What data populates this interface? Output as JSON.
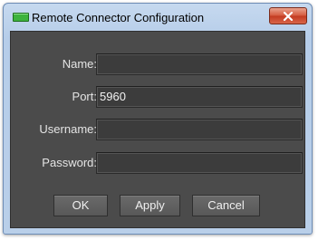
{
  "window": {
    "title": "Remote Connector Configuration"
  },
  "icons": {
    "app": "green-plug-icon",
    "close": "close-x-icon"
  },
  "form": {
    "name_label": "Name:",
    "name_value": "",
    "port_label": "Port:",
    "port_value": "5960",
    "username_label": "Username:",
    "username_value": "",
    "password_label": "Password:",
    "password_value": ""
  },
  "buttons": {
    "ok": "OK",
    "apply": "Apply",
    "cancel": "Cancel"
  },
  "colors": {
    "panel": "#4b4b4b",
    "close_button": "#c2391f",
    "titlebar": "#b6cde9"
  }
}
